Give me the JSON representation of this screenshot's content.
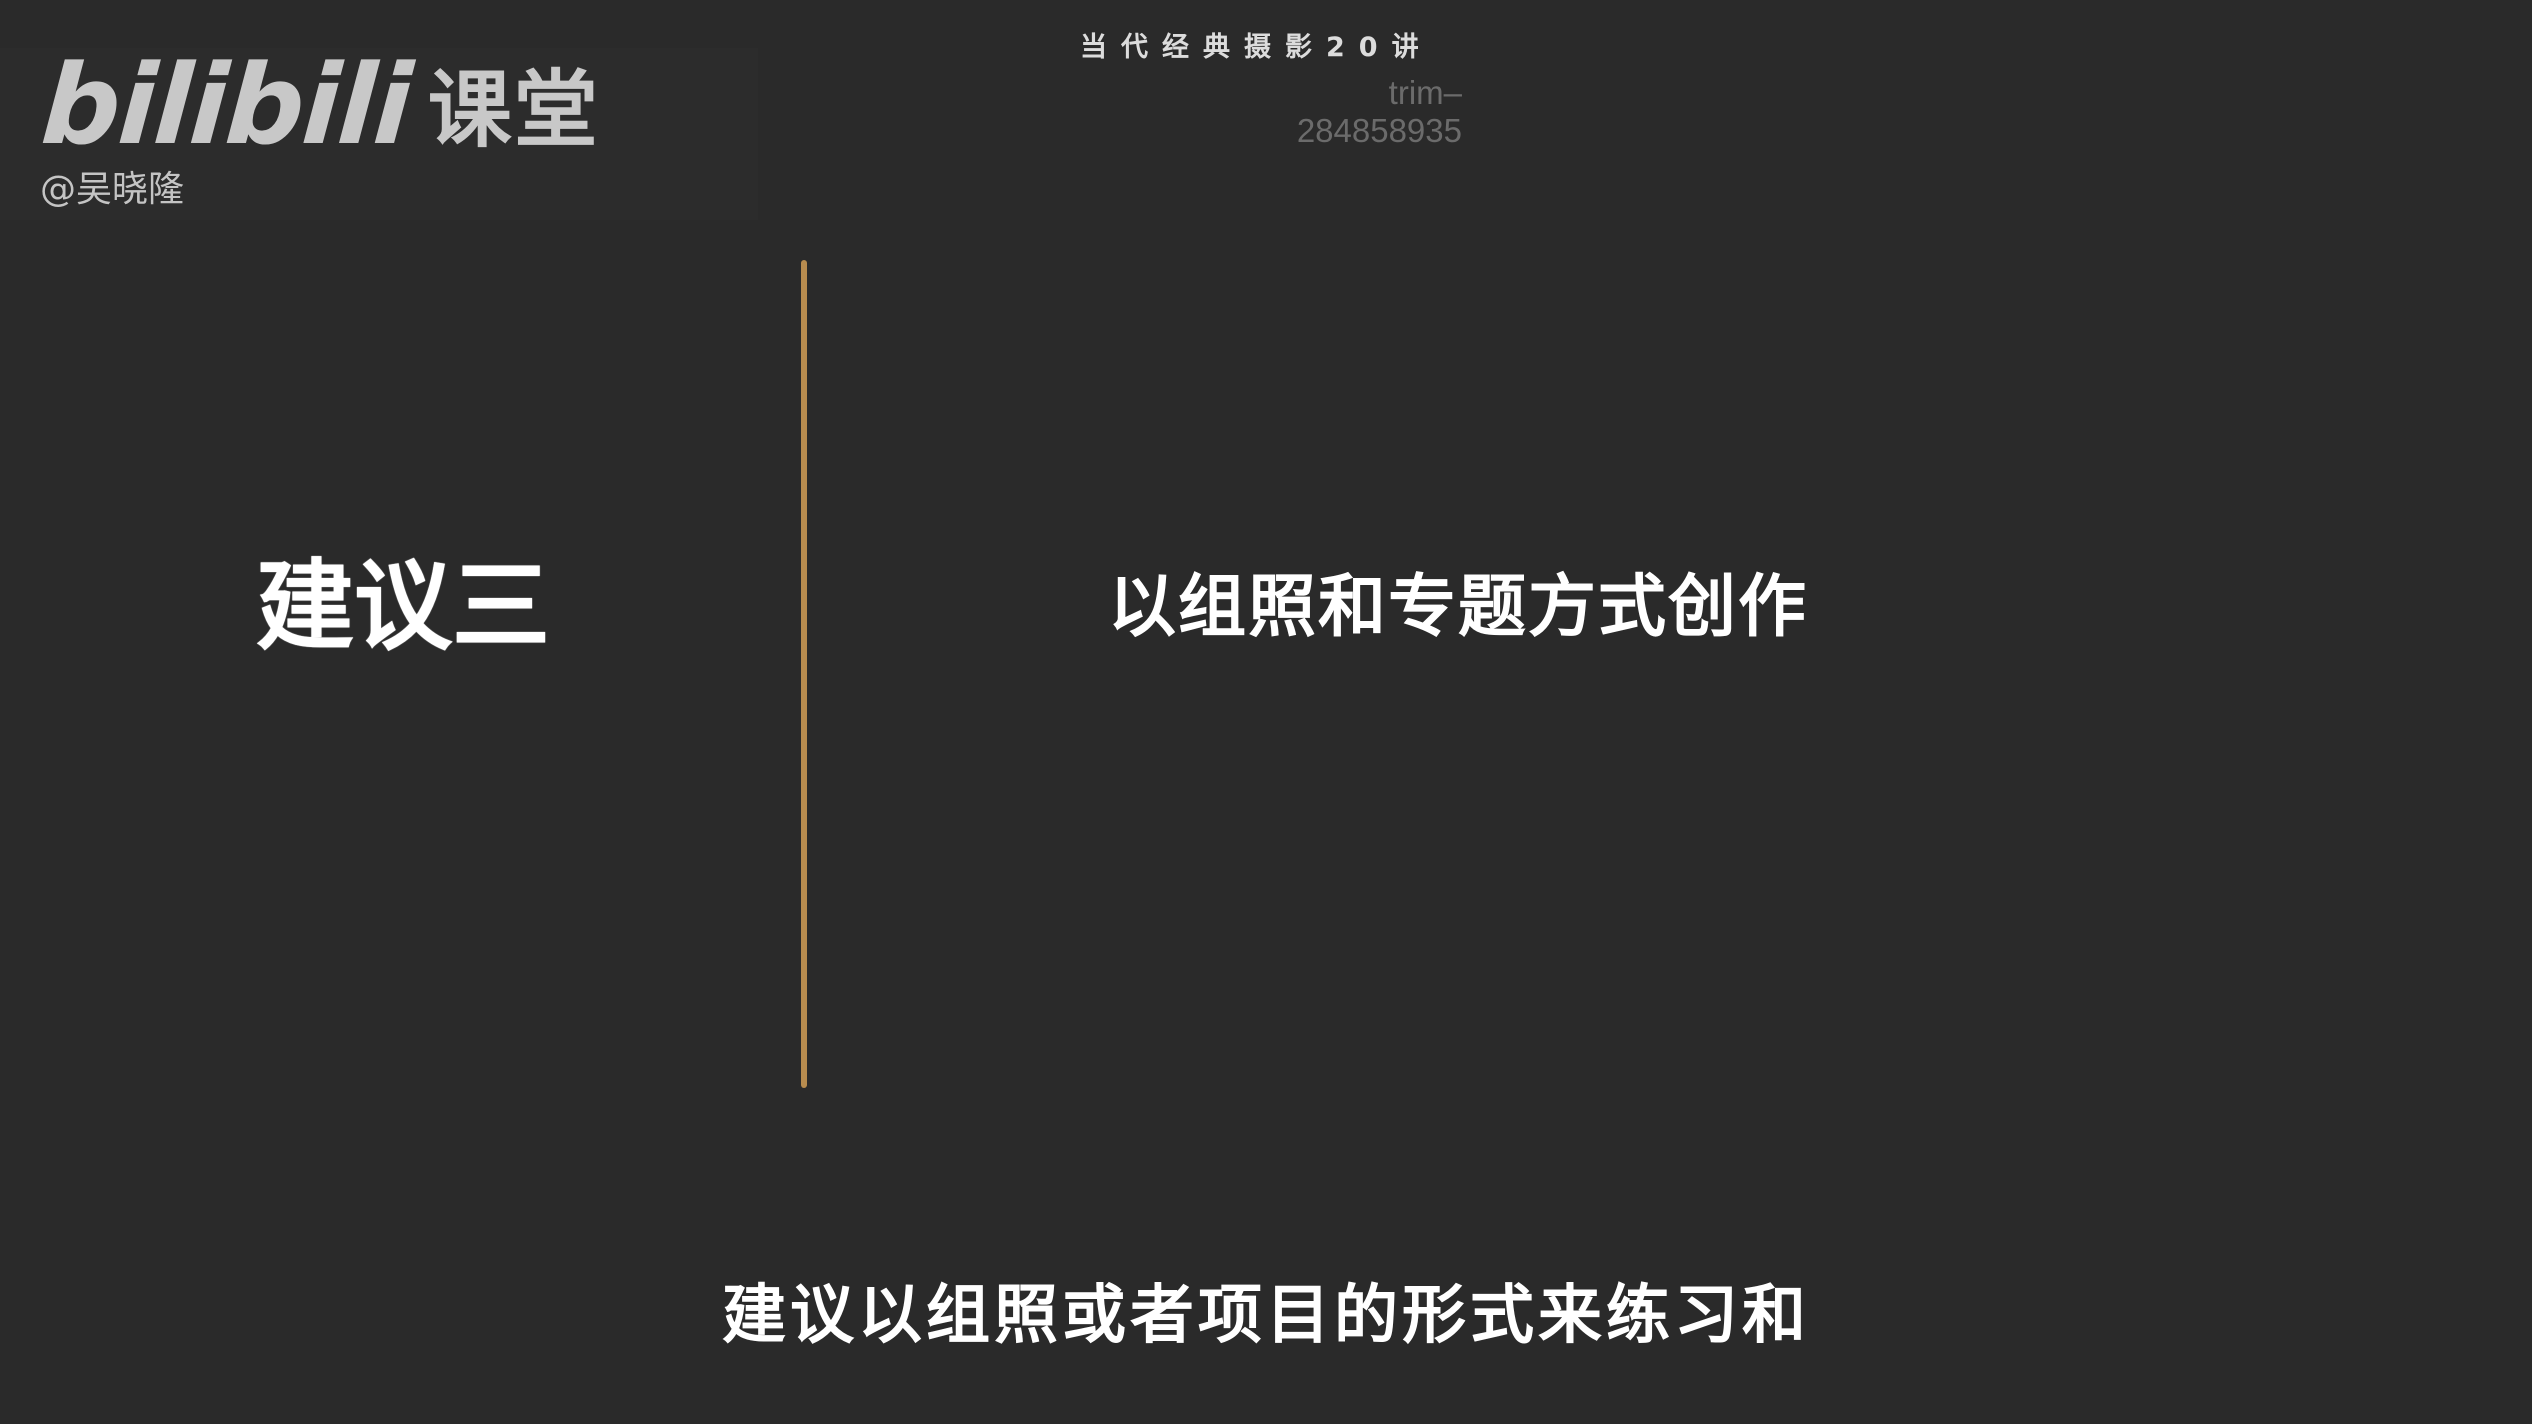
{
  "brand": {
    "logo_bili": "bilibili",
    "logo_ketang": "课堂",
    "author": "@吴晓隆"
  },
  "header": {
    "series_title": "当代经典摄影20讲",
    "trim_id_line1": "trim–",
    "trim_id_line2": "284858935"
  },
  "slide": {
    "section_label": "建议三",
    "section_description": "以组照和专题方式创作"
  },
  "subtitle": {
    "text": "建议以组照或者项目的形式来练习和"
  },
  "colors": {
    "background": "#2a2a2a",
    "divider": "#b88c4f",
    "text_primary": "#ffffff",
    "text_muted": "#6b6b6b"
  }
}
